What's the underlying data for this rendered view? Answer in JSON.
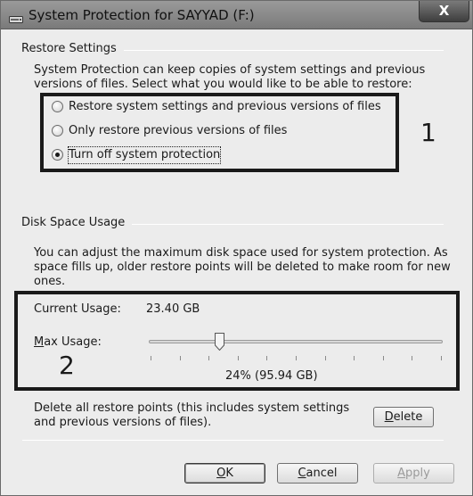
{
  "window": {
    "title": "System Protection for SAYYAD (F:)",
    "close_label": "X"
  },
  "restore_settings": {
    "group_label": "Restore Settings",
    "description_line1": "System Protection can keep copies of system settings and previous",
    "description_line2": "versions of files. Select what you would like to be able to restore:",
    "options": [
      {
        "label": "Restore system settings and previous versions of files",
        "checked": false
      },
      {
        "label": "Only restore previous versions of files",
        "checked": false
      },
      {
        "label": "Turn off system protection",
        "checked": true
      }
    ],
    "annotation_number": "1"
  },
  "disk_space": {
    "group_label": "Disk Space Usage",
    "description_line1": "You can adjust the maximum disk space used for system protection. As",
    "description_line2": "space fills up, older restore points will be deleted to make room for new",
    "description_line3": "ones.",
    "current_usage_label": "Current Usage:",
    "current_usage_value": "23.40 GB",
    "max_usage_label_pre": "",
    "max_usage_label_mnemonic": "M",
    "max_usage_label_post": "ax Usage:",
    "slider_percent": 24,
    "slider_readout": "24% (95.94 GB)",
    "annotation_number": "2"
  },
  "delete_section": {
    "text_line1": "Delete all restore points (this includes system settings",
    "text_line2": "and previous versions of files).",
    "delete_mnemonic": "D",
    "delete_rest": "elete"
  },
  "footer": {
    "ok_mnemonic": "O",
    "ok_rest": "K",
    "cancel_mnemonic": "C",
    "cancel_rest": "ancel",
    "apply_pre": "",
    "apply_mnemonic": "A",
    "apply_rest": "pply"
  }
}
